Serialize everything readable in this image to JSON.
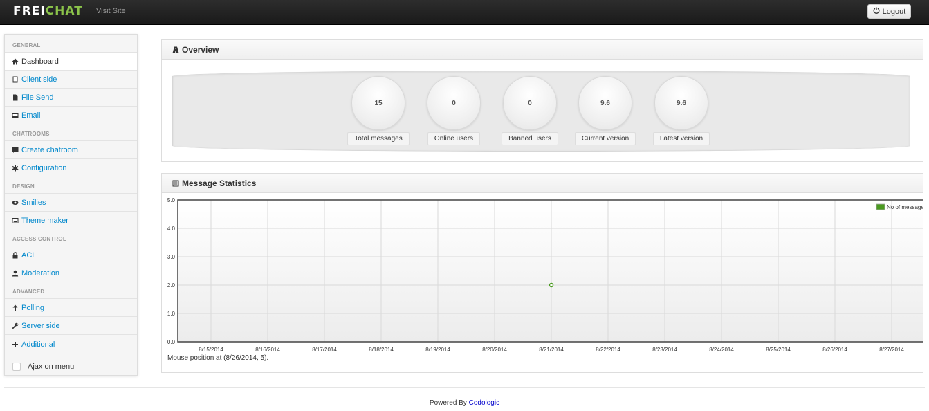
{
  "topbar": {
    "brand_white": "FREI",
    "brand_green": "CHAT",
    "visit_site": "Visit Site",
    "logout": "Logout"
  },
  "sidebar": {
    "sections": [
      {
        "header": "GENERAL",
        "items": [
          {
            "label": "Dashboard",
            "icon": "home-icon",
            "active": true
          },
          {
            "label": "Client side",
            "icon": "book-icon"
          },
          {
            "label": "File Send",
            "icon": "file-icon"
          },
          {
            "label": "Email",
            "icon": "inbox-icon"
          }
        ]
      },
      {
        "header": "CHATROOMS",
        "items": [
          {
            "label": "Create chatroom",
            "icon": "comment-icon"
          },
          {
            "label": "Configuration",
            "icon": "asterisk-icon"
          }
        ]
      },
      {
        "header": "DESIGN",
        "items": [
          {
            "label": "Smilies",
            "icon": "eye-icon"
          },
          {
            "label": "Theme maker",
            "icon": "picture-icon"
          }
        ]
      },
      {
        "header": "ACCESS CONTROL",
        "items": [
          {
            "label": "ACL",
            "icon": "lock-icon"
          },
          {
            "label": "Moderation",
            "icon": "user-icon"
          }
        ]
      },
      {
        "header": "ADVANCED",
        "items": [
          {
            "label": "Polling",
            "icon": "arrow-up-icon"
          },
          {
            "label": "Server side",
            "icon": "wrench-icon"
          },
          {
            "label": "Additional",
            "icon": "plus-icon"
          }
        ]
      }
    ],
    "ajax_label": "Ajax on menu"
  },
  "overview": {
    "title": "Overview",
    "stats": [
      {
        "value": "15",
        "label": "Total messages"
      },
      {
        "value": "0",
        "label": "Online users"
      },
      {
        "value": "0",
        "label": "Banned users"
      },
      {
        "value": "9.6",
        "label": "Current version"
      },
      {
        "value": "9.6",
        "label": "Latest version"
      }
    ]
  },
  "message_stats": {
    "title": "Message Statistics",
    "mouse_position": "Mouse position at (8/26/2014, 5)."
  },
  "chart_data": {
    "type": "scatter",
    "categories": [
      "8/15/2014",
      "8/16/2014",
      "8/17/2014",
      "8/18/2014",
      "8/19/2014",
      "8/20/2014",
      "8/21/2014",
      "8/22/2014",
      "8/23/2014",
      "8/24/2014",
      "8/25/2014",
      "8/26/2014",
      "8/27/2014"
    ],
    "series": [
      {
        "name": "No of messages",
        "color": "#4a9a20",
        "points": [
          {
            "x": "8/21/2014",
            "y": 2
          }
        ]
      }
    ],
    "yticks": [
      "0.0",
      "1.0",
      "2.0",
      "3.0",
      "4.0",
      "5.0"
    ],
    "ylim": [
      0,
      5
    ],
    "grid": true,
    "legend": "top-right"
  },
  "footer": {
    "prefix": "Powered By ",
    "link": "Codologic"
  }
}
